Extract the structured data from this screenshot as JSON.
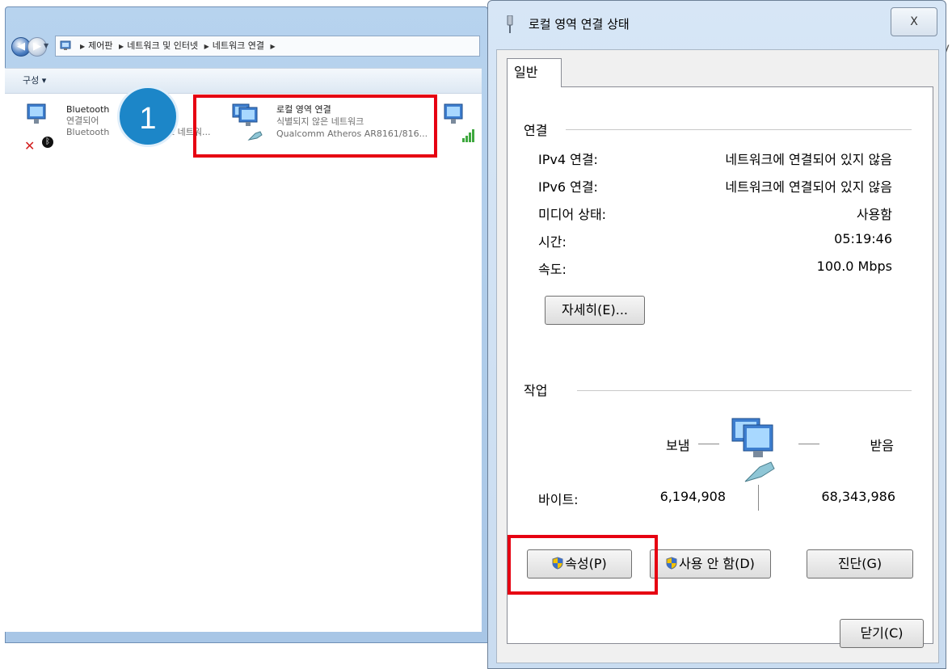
{
  "explorer": {
    "breadcrumbs": [
      "제어판",
      "네트워크 및 인터넷",
      "네트워크 연결"
    ],
    "toolbar": {
      "organize_label": "구성 ▾"
    },
    "items": [
      {
        "name": "Bluetooth",
        "status": "연결되어",
        "device": "Bluetooth",
        "device_tail": "크 네트워..."
      },
      {
        "name": "로컬 영역 연결",
        "status": "식별되지 않은 네트워크",
        "device": "Qualcomm Atheros AR8161/816..."
      }
    ],
    "step_badge": "1",
    "overflow_letter": "V"
  },
  "dialog": {
    "title": "로컬 영역 연결 상태",
    "close_label": "X",
    "tab_label": "일반",
    "connection": {
      "group_title": "연결",
      "rows": [
        {
          "label": "IPv4 연결:",
          "value": "네트워크에 연결되어 있지 않음"
        },
        {
          "label": "IPv6 연결:",
          "value": "네트워크에 연결되어 있지 않음"
        },
        {
          "label": "미디어 상태:",
          "value": "사용함"
        },
        {
          "label": "시간:",
          "value": "05:19:46"
        },
        {
          "label": "속도:",
          "value": "100.0 Mbps"
        }
      ],
      "details_label": "자세히(E)..."
    },
    "activity": {
      "group_title": "작업",
      "sent_label": "보냄",
      "received_label": "받음",
      "bytes_label": "바이트:",
      "bytes_sent": "6,194,908",
      "bytes_received": "68,343,986"
    },
    "buttons": {
      "properties": "속성(P)",
      "disable": "사용 안 함(D)",
      "diagnose": "진단(G)",
      "close": "닫기(C)"
    }
  },
  "colors": {
    "highlight": "#e60012",
    "badge": "#1c86c8"
  }
}
